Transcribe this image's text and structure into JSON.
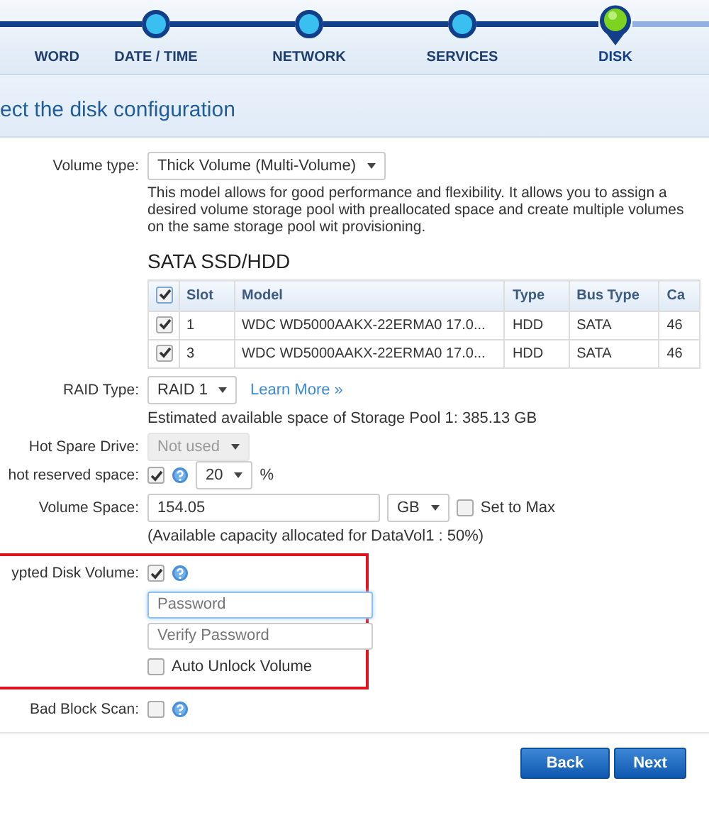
{
  "stepper": {
    "steps": [
      {
        "label": "WORD",
        "selected": false
      },
      {
        "label": "DATE / TIME",
        "selected": false
      },
      {
        "label": "NETWORK",
        "selected": false
      },
      {
        "label": "SERVICES",
        "selected": false
      },
      {
        "label": "DISK",
        "selected": true
      }
    ]
  },
  "title": "ect the disk configuration",
  "form": {
    "volume_type": {
      "label": "Volume type:",
      "value": "Thick Volume (Multi-Volume)",
      "description": "This model allows for good performance and flexibility. It allows you to assign a desired volume storage pool with preallocated space and create multiple volumes on the same storage pool wit provisioning."
    },
    "disk_table": {
      "heading": "SATA SSD/HDD",
      "select_all_checked": true,
      "columns": [
        "Slot",
        "Model",
        "Type",
        "Bus Type",
        "Ca"
      ],
      "rows": [
        {
          "checked": true,
          "cells": [
            "1",
            "WDC WD5000AAKX-22ERMA0 17.0...",
            "HDD",
            "SATA",
            "46"
          ]
        },
        {
          "checked": true,
          "cells": [
            "3",
            "WDC WD5000AAKX-22ERMA0 17.0...",
            "HDD",
            "SATA",
            "46"
          ]
        }
      ]
    },
    "raid_type": {
      "label": "RAID Type:",
      "value": "RAID 1",
      "link": "Learn More »",
      "note": "Estimated available space of Storage Pool 1: 385.13 GB"
    },
    "hot_spare": {
      "label": "Hot Spare Drive:",
      "value": "Not used",
      "disabled": true
    },
    "snapshot": {
      "label": "hot reserved space:",
      "checked": true,
      "value": "20",
      "unit": "%"
    },
    "volume_space": {
      "label": "Volume Space:",
      "value": "154.05",
      "unit": "GB",
      "set_to_max": {
        "label": "Set to Max",
        "checked": false
      },
      "note": "(Available capacity allocated for DataVol1 : 50%)"
    },
    "encryption": {
      "label": "ypted Disk Volume:",
      "checked": true,
      "password": {
        "placeholder": "Password",
        "focused": true
      },
      "verify": {
        "placeholder": "Verify Password",
        "focused": false
      },
      "auto_unlock": {
        "label": "Auto Unlock Volume",
        "checked": false
      }
    },
    "bad_block": {
      "label": "Bad Block Scan:",
      "checked": false
    }
  },
  "buttons": [
    {
      "label": "Back"
    },
    {
      "label": "Next"
    }
  ]
}
